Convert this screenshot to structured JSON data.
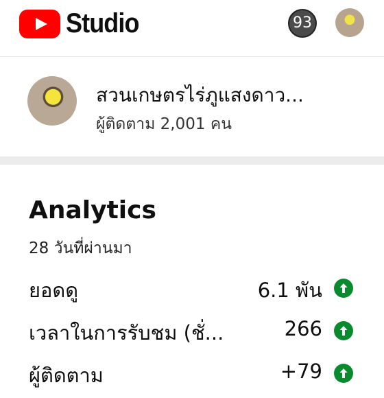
{
  "header": {
    "logo_text": "Studio",
    "notification_count": "93"
  },
  "channel": {
    "name": "สวนเกษตรไร่ภูแสงดาว...",
    "subscribers": "ผู้ติดตาม 2,001 คน"
  },
  "analytics": {
    "title": "Analytics",
    "period": "28 วันที่ผ่านมา",
    "metrics": [
      {
        "label": "ยอดดู",
        "value": "6.1 พัน",
        "trend_icon": "arrow-up-circle-icon"
      },
      {
        "label": "เวลาในการรับชม (ชั่...",
        "value": "266",
        "trend_icon": "arrow-up-circle-icon"
      },
      {
        "label": "ผู้ติดตาม",
        "value": "+79",
        "trend_icon": "arrow-up-circle-icon"
      }
    ]
  },
  "colors": {
    "brand_red": "#ff0000",
    "trend_up_green": "#0a8a2e"
  }
}
